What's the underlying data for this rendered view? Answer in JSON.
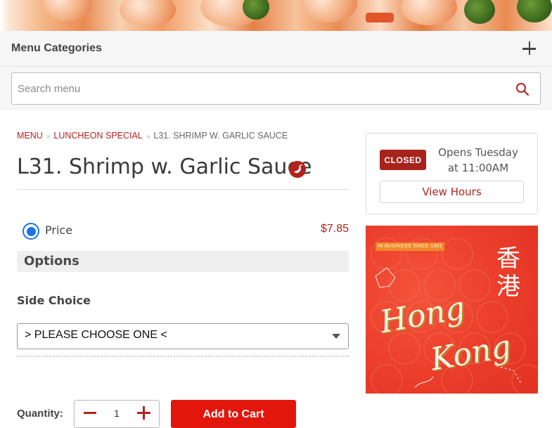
{
  "header": {
    "categories_title": "Menu Categories"
  },
  "search": {
    "placeholder": "Search menu"
  },
  "breadcrumb": {
    "items": [
      "MENU",
      "LUNCHEON SPECIAL"
    ],
    "current": "L31. SHRIMP W. GARLIC SAUCE"
  },
  "item": {
    "title": "L31. Shrimp w. Garlic Sauce",
    "spicy": true,
    "price_label": "Price",
    "price_value": "$7.85",
    "options_title": "Options",
    "side_choice_label": "Side Choice",
    "side_choice_selected": "> PLEASE CHOOSE ONE <"
  },
  "cart": {
    "quantity_label": "Quantity:",
    "quantity_value": "1",
    "add_label": "Add to Cart"
  },
  "hours": {
    "status_badge": "CLOSED",
    "opens_line1": "Opens Tuesday",
    "opens_line2": "at 11:00AM",
    "view_hours_label": "View Hours"
  },
  "promo": {
    "banner": "IN BUSINESS SINCE 1991",
    "cjk_1": "香",
    "cjk_2": "港",
    "word_1": "Hong",
    "word_2": "Kong"
  },
  "colors": {
    "accent": "#b3231c",
    "cta": "#e2160b",
    "radio": "#1a73e8"
  }
}
